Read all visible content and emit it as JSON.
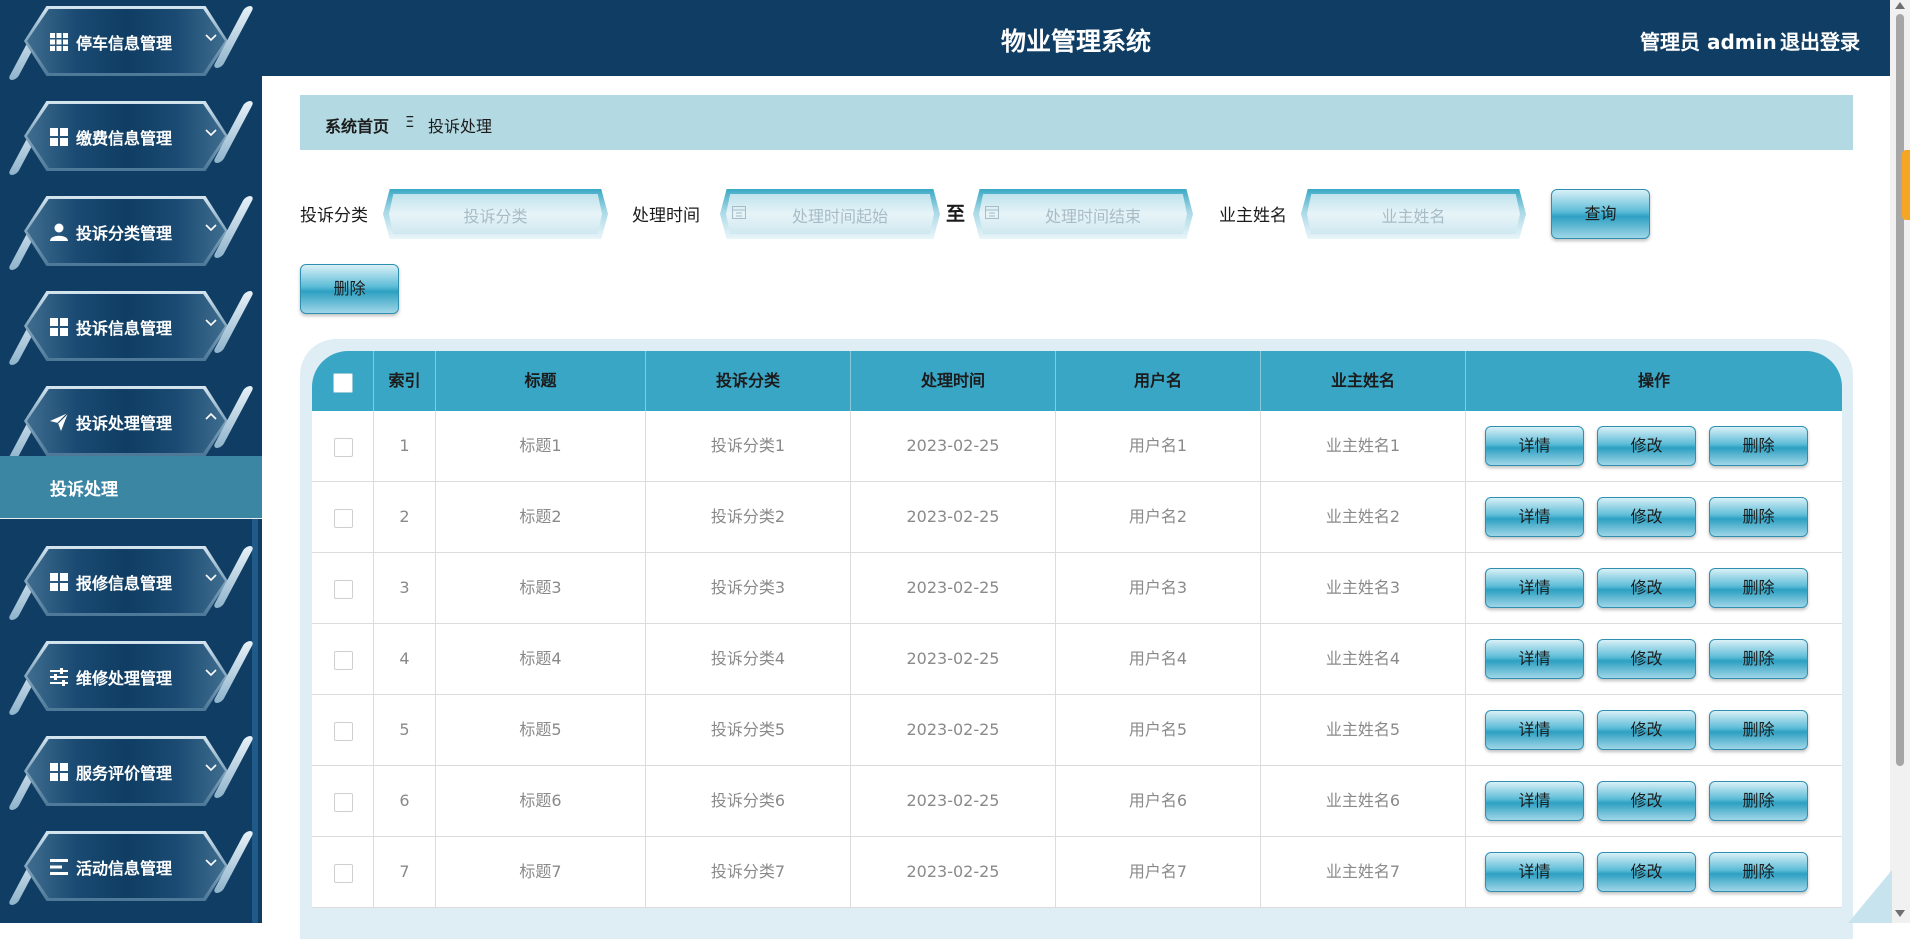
{
  "app": {
    "title": "物业管理系统",
    "user": "管理员 admin",
    "logout": "退出登录"
  },
  "sidebar": {
    "items": [
      {
        "label": "停车信息管理",
        "icon": "grid-icon",
        "expanded": false
      },
      {
        "label": "缴费信息管理",
        "icon": "grid-icon",
        "expanded": false
      },
      {
        "label": "投诉分类管理",
        "icon": "user-icon",
        "expanded": false
      },
      {
        "label": "投诉信息管理",
        "icon": "grid-icon",
        "expanded": false
      },
      {
        "label": "投诉处理管理",
        "icon": "paper-plane-icon",
        "expanded": true
      },
      {
        "label": "报修信息管理",
        "icon": "grid-icon",
        "expanded": false
      },
      {
        "label": "维修处理管理",
        "icon": "sliders-icon",
        "expanded": false
      },
      {
        "label": "服务评价管理",
        "icon": "grid-icon",
        "expanded": false
      },
      {
        "label": "活动信息管理",
        "icon": "list-icon",
        "expanded": false
      }
    ],
    "submenu": {
      "label": "投诉处理"
    }
  },
  "breadcrumb": {
    "home": "系统首页",
    "separator": "Ξ",
    "current": "投诉处理"
  },
  "search": {
    "category_label": "投诉分类",
    "category_placeholder": "投诉分类",
    "time_label": "处理时间",
    "time_start_placeholder": "处理时间起始",
    "to_label": "至",
    "time_end_placeholder": "处理时间结束",
    "owner_label": "业主姓名",
    "owner_placeholder": "业主姓名",
    "query_button": "查询",
    "delete_button": "删除"
  },
  "table": {
    "columns": [
      "索引",
      "标题",
      "投诉分类",
      "处理时间",
      "用户名",
      "业主姓名",
      "操作"
    ],
    "action_labels": {
      "detail": "详情",
      "edit": "修改",
      "delete": "删除"
    },
    "rows": [
      {
        "index": "1",
        "title": "标题1",
        "category": "投诉分类1",
        "time": "2023-02-25",
        "username": "用户名1",
        "owner": "业主姓名1"
      },
      {
        "index": "2",
        "title": "标题2",
        "category": "投诉分类2",
        "time": "2023-02-25",
        "username": "用户名2",
        "owner": "业主姓名2"
      },
      {
        "index": "3",
        "title": "标题3",
        "category": "投诉分类3",
        "time": "2023-02-25",
        "username": "用户名3",
        "owner": "业主姓名3"
      },
      {
        "index": "4",
        "title": "标题4",
        "category": "投诉分类4",
        "time": "2023-02-25",
        "username": "用户名4",
        "owner": "业主姓名4"
      },
      {
        "index": "5",
        "title": "标题5",
        "category": "投诉分类5",
        "time": "2023-02-25",
        "username": "用户名5",
        "owner": "业主姓名5"
      },
      {
        "index": "6",
        "title": "标题6",
        "category": "投诉分类6",
        "time": "2023-02-25",
        "username": "用户名6",
        "owner": "业主姓名6"
      },
      {
        "index": "7",
        "title": "标题7",
        "category": "投诉分类7",
        "time": "2023-02-25",
        "username": "用户名7",
        "owner": "业主姓名7"
      }
    ]
  },
  "colors": {
    "navy": "#0f3d63",
    "teal_header": "#3aa6c6",
    "breadcrumb_bg": "#b3d9e3",
    "submenu_bg": "#3b86a3"
  }
}
